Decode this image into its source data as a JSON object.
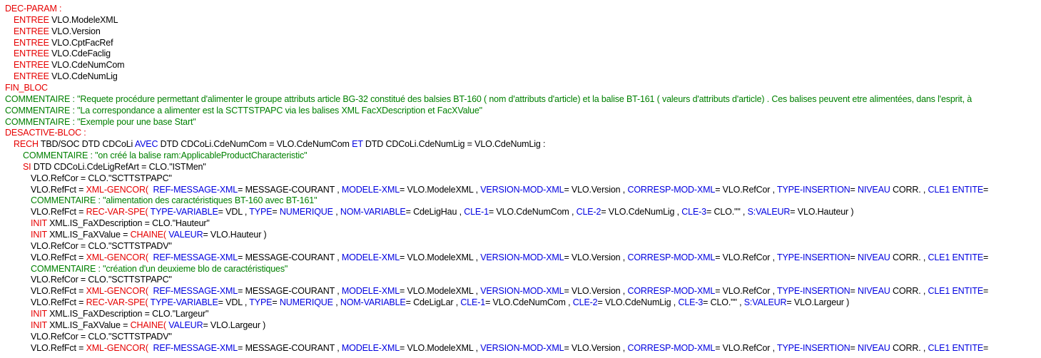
{
  "colors": {
    "red": "#e60000",
    "green": "#008000",
    "blue": "#0000e0",
    "black": "#000000",
    "background": "#ffffff"
  },
  "code_lines": [
    {
      "indent": 0,
      "tokens": [
        {
          "t": "DEC-PARAM",
          "c": "red"
        },
        {
          "t": " :",
          "c": "red"
        }
      ]
    },
    {
      "indent": 1,
      "tokens": [
        {
          "t": "ENTREE",
          "c": "red"
        },
        {
          "t": " VLO.ModeleXML",
          "c": "black"
        }
      ]
    },
    {
      "indent": 1,
      "tokens": [
        {
          "t": "ENTREE",
          "c": "red"
        },
        {
          "t": " VLO.Version",
          "c": "black"
        }
      ]
    },
    {
      "indent": 1,
      "tokens": [
        {
          "t": "ENTREE",
          "c": "red"
        },
        {
          "t": " VLO.CptFacRef",
          "c": "black"
        }
      ]
    },
    {
      "indent": 1,
      "tokens": [
        {
          "t": "ENTREE",
          "c": "red"
        },
        {
          "t": " VLO.CdeFaclig",
          "c": "black"
        }
      ]
    },
    {
      "indent": 1,
      "tokens": [
        {
          "t": "ENTREE",
          "c": "red"
        },
        {
          "t": " VLO.CdeNumCom",
          "c": "black"
        }
      ]
    },
    {
      "indent": 1,
      "tokens": [
        {
          "t": "ENTREE",
          "c": "red"
        },
        {
          "t": " VLO.CdeNumLig",
          "c": "black"
        }
      ]
    },
    {
      "indent": 0,
      "tokens": [
        {
          "t": "FIN_BLOC",
          "c": "red"
        }
      ]
    },
    {
      "indent": 0,
      "tokens": [
        {
          "t": "COMMENTAIRE : \"Requete procédure permettant d'alimenter le groupe attributs article BG-32 constitué des balsies BT-160 ( nom d'attributs d'article) et la balise BT-161 ( valeurs d'attributs d'article) . Ces balises peuvent etre alimentées, dans l'esprit, à",
          "c": "green"
        }
      ]
    },
    {
      "indent": 0,
      "tokens": [
        {
          "t": "COMMENTAIRE : \"La correspondance a alimenter est la SCTTSTPAPC via les balises XML FacXDescription et FacXValue\"",
          "c": "green"
        }
      ]
    },
    {
      "indent": 0,
      "tokens": [
        {
          "t": "COMMENTAIRE : \"Exemple pour une base Start\"",
          "c": "green"
        }
      ]
    },
    {
      "indent": 0,
      "tokens": [
        {
          "t": "DESACTIVE-BLOC",
          "c": "red"
        },
        {
          "t": " :",
          "c": "red"
        }
      ]
    },
    {
      "indent": 1,
      "tokens": [
        {
          "t": "RECH",
          "c": "red"
        },
        {
          "t": " TBD/SOC DTD CDCoLi ",
          "c": "black"
        },
        {
          "t": "AVEC",
          "c": "blue"
        },
        {
          "t": " DTD CDCoLi.CdeNumCom = VLO.CdeNumCom ",
          "c": "black"
        },
        {
          "t": "ET",
          "c": "blue"
        },
        {
          "t": " DTD CDCoLi.CdeNumLig = VLO.CdeNumLig :",
          "c": "black"
        }
      ]
    },
    {
      "indent": 2,
      "tokens": [
        {
          "t": "COMMENTAIRE : \"on créé la balise ram:ApplicableProductCharacteristic\"",
          "c": "green"
        }
      ]
    },
    {
      "indent": 2,
      "tokens": [
        {
          "t": "SI",
          "c": "red"
        },
        {
          "t": " DTD CDCoLi.CdeLigRefArt = CLO.\"ISTMen\"",
          "c": "black"
        }
      ]
    },
    {
      "indent": 3,
      "tokens": [
        {
          "t": "VLO.RefCor = CLO.\"SCTTSTPAPC\"",
          "c": "black"
        }
      ]
    },
    {
      "indent": 3,
      "tokens": [
        {
          "t": "VLO.RefFct = ",
          "c": "black"
        },
        {
          "t": "XML-GENCOR(",
          "c": "red"
        },
        {
          "t": "  ",
          "c": "black"
        },
        {
          "t": "REF-MESSAGE-XML",
          "c": "blue"
        },
        {
          "t": "= MESSAGE-COURANT , ",
          "c": "black"
        },
        {
          "t": "MODELE-XML",
          "c": "blue"
        },
        {
          "t": "= VLO.ModeleXML , ",
          "c": "black"
        },
        {
          "t": "VERSION-MOD-XML",
          "c": "blue"
        },
        {
          "t": "= VLO.Version , ",
          "c": "black"
        },
        {
          "t": "CORRESP-MOD-XML",
          "c": "blue"
        },
        {
          "t": "= VLO.RefCor , ",
          "c": "black"
        },
        {
          "t": "TYPE-INSERTION",
          "c": "blue"
        },
        {
          "t": "= ",
          "c": "black"
        },
        {
          "t": "NIVEAU",
          "c": "blue"
        },
        {
          "t": " CORR. , ",
          "c": "black"
        },
        {
          "t": "CLE1 ENTITE",
          "c": "blue"
        },
        {
          "t": "=",
          "c": "black"
        }
      ]
    },
    {
      "indent": 3,
      "tokens": [
        {
          "t": "COMMENTAIRE : \"alimentation des caractéristiques BT-160 avec BT-161\"",
          "c": "green"
        }
      ]
    },
    {
      "indent": 3,
      "tokens": [
        {
          "t": "VLO.RefFct = ",
          "c": "black"
        },
        {
          "t": "REC-VAR-SPE(",
          "c": "red"
        },
        {
          "t": " ",
          "c": "black"
        },
        {
          "t": "TYPE-VARIABLE",
          "c": "blue"
        },
        {
          "t": "= VDL , ",
          "c": "black"
        },
        {
          "t": "TYPE",
          "c": "blue"
        },
        {
          "t": "= ",
          "c": "black"
        },
        {
          "t": "NUMERIQUE",
          "c": "blue"
        },
        {
          "t": " , ",
          "c": "black"
        },
        {
          "t": "NOM-VARIABLE",
          "c": "blue"
        },
        {
          "t": "= CdeLigHau , ",
          "c": "black"
        },
        {
          "t": "CLE-1",
          "c": "blue"
        },
        {
          "t": "= VLO.CdeNumCom , ",
          "c": "black"
        },
        {
          "t": "CLE-2",
          "c": "blue"
        },
        {
          "t": "= VLO.CdeNumLig , ",
          "c": "black"
        },
        {
          "t": "CLE-3",
          "c": "blue"
        },
        {
          "t": "= CLO.\"\" , ",
          "c": "black"
        },
        {
          "t": "S:VALEUR",
          "c": "blue"
        },
        {
          "t": "= VLO.Hauteur )",
          "c": "black"
        }
      ]
    },
    {
      "indent": 3,
      "tokens": [
        {
          "t": "INIT",
          "c": "red"
        },
        {
          "t": " XML.IS_FaXDescription = CLO.\"Hauteur\"",
          "c": "black"
        }
      ]
    },
    {
      "indent": 3,
      "tokens": [
        {
          "t": "INIT",
          "c": "red"
        },
        {
          "t": " XML.IS_FaXValue = ",
          "c": "black"
        },
        {
          "t": "CHAINE(",
          "c": "red"
        },
        {
          "t": " ",
          "c": "black"
        },
        {
          "t": "VALEUR",
          "c": "blue"
        },
        {
          "t": "= VLO.Hauteur )",
          "c": "black"
        }
      ]
    },
    {
      "indent": 3,
      "tokens": [
        {
          "t": "VLO.RefCor = CLO.\"SCTTSTPADV\"",
          "c": "black"
        }
      ]
    },
    {
      "indent": 3,
      "tokens": [
        {
          "t": "VLO.RefFct = ",
          "c": "black"
        },
        {
          "t": "XML-GENCOR(",
          "c": "red"
        },
        {
          "t": "  ",
          "c": "black"
        },
        {
          "t": "REF-MESSAGE-XML",
          "c": "blue"
        },
        {
          "t": "= MESSAGE-COURANT , ",
          "c": "black"
        },
        {
          "t": "MODELE-XML",
          "c": "blue"
        },
        {
          "t": "= VLO.ModeleXML , ",
          "c": "black"
        },
        {
          "t": "VERSION-MOD-XML",
          "c": "blue"
        },
        {
          "t": "= VLO.Version , ",
          "c": "black"
        },
        {
          "t": "CORRESP-MOD-XML",
          "c": "blue"
        },
        {
          "t": "= VLO.RefCor , ",
          "c": "black"
        },
        {
          "t": "TYPE-INSERTION",
          "c": "blue"
        },
        {
          "t": "= ",
          "c": "black"
        },
        {
          "t": "NIVEAU",
          "c": "blue"
        },
        {
          "t": " CORR. , ",
          "c": "black"
        },
        {
          "t": "CLE1 ENTITE",
          "c": "blue"
        },
        {
          "t": "=",
          "c": "black"
        }
      ]
    },
    {
      "indent": 3,
      "tokens": [
        {
          "t": "COMMENTAIRE : \"création d'un deuxieme blo de caractéristiques\"",
          "c": "green"
        }
      ]
    },
    {
      "indent": 3,
      "tokens": [
        {
          "t": "VLO.RefCor = CLO.\"SCTTSTPAPC\"",
          "c": "black"
        }
      ]
    },
    {
      "indent": 3,
      "tokens": [
        {
          "t": "VLO.RefFct = ",
          "c": "black"
        },
        {
          "t": "XML-GENCOR(",
          "c": "red"
        },
        {
          "t": "  ",
          "c": "black"
        },
        {
          "t": "REF-MESSAGE-XML",
          "c": "blue"
        },
        {
          "t": "= MESSAGE-COURANT , ",
          "c": "black"
        },
        {
          "t": "MODELE-XML",
          "c": "blue"
        },
        {
          "t": "= VLO.ModeleXML , ",
          "c": "black"
        },
        {
          "t": "VERSION-MOD-XML",
          "c": "blue"
        },
        {
          "t": "= VLO.Version , ",
          "c": "black"
        },
        {
          "t": "CORRESP-MOD-XML",
          "c": "blue"
        },
        {
          "t": "= VLO.RefCor , ",
          "c": "black"
        },
        {
          "t": "TYPE-INSERTION",
          "c": "blue"
        },
        {
          "t": "= ",
          "c": "black"
        },
        {
          "t": "NIVEAU",
          "c": "blue"
        },
        {
          "t": " CORR. , ",
          "c": "black"
        },
        {
          "t": "CLE1 ENTITE",
          "c": "blue"
        },
        {
          "t": "=",
          "c": "black"
        }
      ]
    },
    {
      "indent": 3,
      "tokens": [
        {
          "t": "VLO.RefFct = ",
          "c": "black"
        },
        {
          "t": "REC-VAR-SPE(",
          "c": "red"
        },
        {
          "t": " ",
          "c": "black"
        },
        {
          "t": "TYPE-VARIABLE",
          "c": "blue"
        },
        {
          "t": "= VDL , ",
          "c": "black"
        },
        {
          "t": "TYPE",
          "c": "blue"
        },
        {
          "t": "= ",
          "c": "black"
        },
        {
          "t": "NUMERIQUE",
          "c": "blue"
        },
        {
          "t": " , ",
          "c": "black"
        },
        {
          "t": "NOM-VARIABLE",
          "c": "blue"
        },
        {
          "t": "= CdeLigLar , ",
          "c": "black"
        },
        {
          "t": "CLE-1",
          "c": "blue"
        },
        {
          "t": "= VLO.CdeNumCom , ",
          "c": "black"
        },
        {
          "t": "CLE-2",
          "c": "blue"
        },
        {
          "t": "= VLO.CdeNumLig , ",
          "c": "black"
        },
        {
          "t": "CLE-3",
          "c": "blue"
        },
        {
          "t": "= CLO.\"\" , ",
          "c": "black"
        },
        {
          "t": "S:VALEUR",
          "c": "blue"
        },
        {
          "t": "= VLO.Largeur )",
          "c": "black"
        }
      ]
    },
    {
      "indent": 3,
      "tokens": [
        {
          "t": "INIT",
          "c": "red"
        },
        {
          "t": " XML.IS_FaXDescription = CLO.\"Largeur\"",
          "c": "black"
        }
      ]
    },
    {
      "indent": 3,
      "tokens": [
        {
          "t": "INIT",
          "c": "red"
        },
        {
          "t": " XML.IS_FaXValue = ",
          "c": "black"
        },
        {
          "t": "CHAINE(",
          "c": "red"
        },
        {
          "t": " ",
          "c": "black"
        },
        {
          "t": "VALEUR",
          "c": "blue"
        },
        {
          "t": "= VLO.Largeur )",
          "c": "black"
        }
      ]
    },
    {
      "indent": 3,
      "tokens": [
        {
          "t": "VLO.RefCor = CLO.\"SCTTSTPADV\"",
          "c": "black"
        }
      ]
    },
    {
      "indent": 3,
      "tokens": [
        {
          "t": "VLO.RefFct = ",
          "c": "black"
        },
        {
          "t": "XML-GENCOR(",
          "c": "red"
        },
        {
          "t": "  ",
          "c": "black"
        },
        {
          "t": "REF-MESSAGE-XML",
          "c": "blue"
        },
        {
          "t": "= MESSAGE-COURANT , ",
          "c": "black"
        },
        {
          "t": "MODELE-XML",
          "c": "blue"
        },
        {
          "t": "= VLO.ModeleXML , ",
          "c": "black"
        },
        {
          "t": "VERSION-MOD-XML",
          "c": "blue"
        },
        {
          "t": "= VLO.Version , ",
          "c": "black"
        },
        {
          "t": "CORRESP-MOD-XML",
          "c": "blue"
        },
        {
          "t": "= VLO.RefCor , ",
          "c": "black"
        },
        {
          "t": "TYPE-INSERTION",
          "c": "blue"
        },
        {
          "t": "= ",
          "c": "black"
        },
        {
          "t": "NIVEAU",
          "c": "blue"
        },
        {
          "t": " CORR. , ",
          "c": "black"
        },
        {
          "t": "CLE1 ENTITE",
          "c": "blue"
        },
        {
          "t": "=",
          "c": "black"
        }
      ]
    }
  ]
}
